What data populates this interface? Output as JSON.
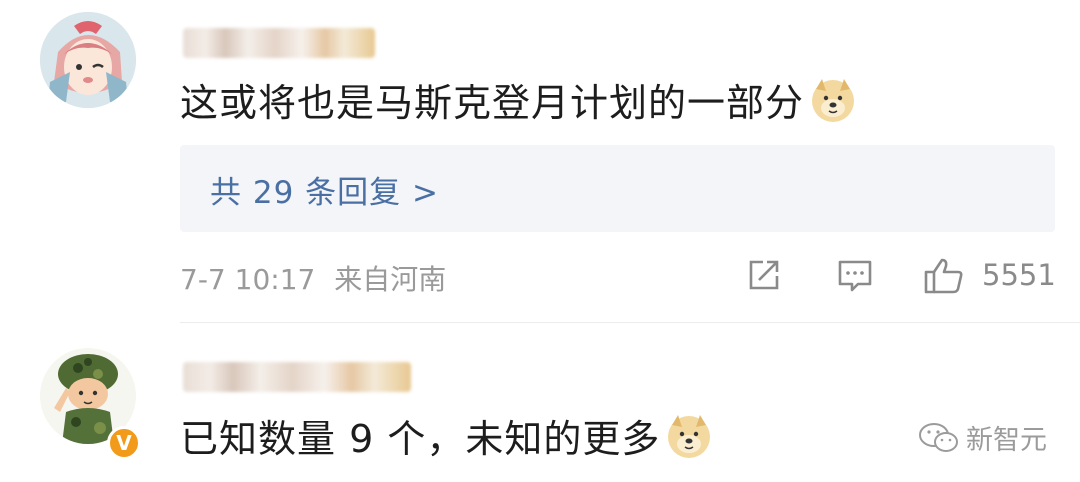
{
  "comments": [
    {
      "text": "这或将也是马斯克登月计划的一部分",
      "replies_label": "共 29 条回复 >",
      "date": "7-7 10:17",
      "source": "来自河南",
      "likes": "5551",
      "emoji": "doge-emoji"
    },
    {
      "text": "已知数量 9 个，未知的更多",
      "emoji": "doge-emoji",
      "verified_badge": "V"
    }
  ],
  "watermark": {
    "text": "新智元",
    "icon": "wechat-icon"
  },
  "colors": {
    "reply_link": "#4a6fa3",
    "meta": "#9a9a9a",
    "badge": "#f29a1a",
    "reply_bg": "#f3f5f9"
  }
}
